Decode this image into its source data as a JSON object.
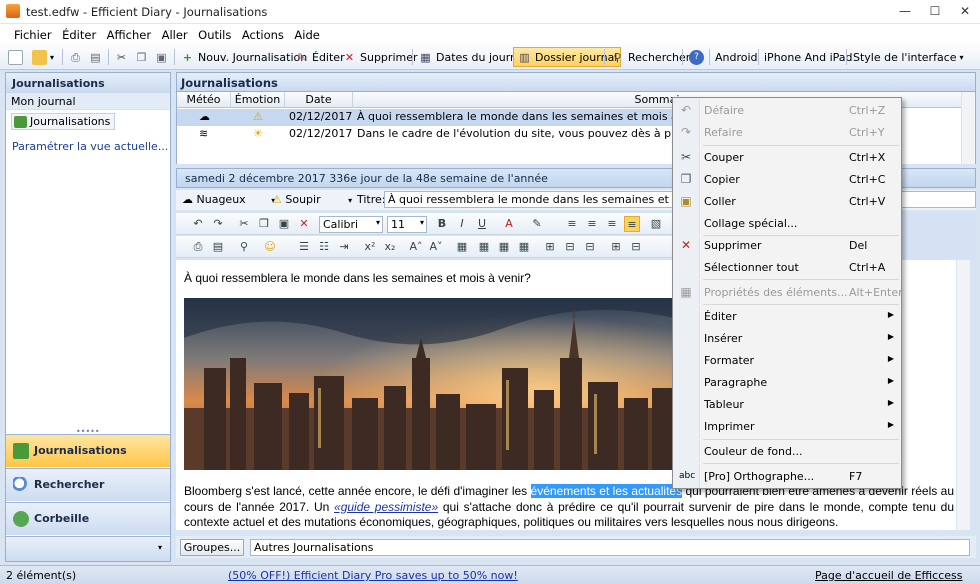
{
  "window": {
    "title": "test.edfw - Efficient Diary - Journalisations",
    "minimize": "—",
    "maximize": "☐",
    "close": "✕"
  },
  "menubar": [
    "Fichier",
    "Éditer",
    "Afficher",
    "Aller",
    "Outils",
    "Actions",
    "Aide"
  ],
  "toolbar": {
    "new_entry": "Nouv. Journalisation",
    "edit": "Éditer",
    "delete": "Supprimer",
    "dates": "Dates du journal",
    "folder": "Dossier journal",
    "search": "Rechercher",
    "help": "?",
    "android": "Android",
    "iphone": "iPhone And iPad",
    "style": "Style de l'interface"
  },
  "left_panel": {
    "header": "Journalisations",
    "journal": "Mon journal",
    "item": "Journalisations",
    "link": "Paramétrer la vue actuelle...",
    "nav": [
      "Journalisations",
      "Rechercher",
      "Corbeille"
    ]
  },
  "main": {
    "header": "Journalisations",
    "columns": [
      "Météo",
      "Émotion",
      "Date",
      "Sommaire"
    ],
    "rows": [
      {
        "date": "02/12/2017",
        "summary": "À quoi ressemblera le monde dans les semaines et mois à venir?"
      },
      {
        "date": "02/12/2017",
        "summary": "Dans le cadre de l'évolution du site, vous pouvez dès à présent prendre"
      }
    ],
    "date_bar": "samedi 2 décembre 2017   336e jour de la 48e semaine de l'année",
    "weather": "Nuageux",
    "emotion": "Soupir",
    "title_label": "Titre:",
    "title_value": "À quoi ressemblera le monde dans les semaines et mois à venir?",
    "font": "Calibri",
    "size": "11"
  },
  "editor": {
    "question": "À quoi ressemblera le monde dans les semaines et mois à venir?",
    "p1": "Bloomberg s'est lancé, cette année encore, le défi d'imaginer les ",
    "highlight": "événements et les actualités",
    "p2": " qui pourraient bien être amenés à devenir réels au cours de l'année 2017. Un ",
    "link": "«guide pessimiste»",
    "p3": " qui s'attache donc à prédire ce qu'il pourrait survenir de pire dans le monde, compte tenu du contexte actuel et des mutations économiques, géographiques, politiques ou militaires vers lesquelles nous nous dirigeons."
  },
  "bottombar": {
    "groups_button": "Groupes...",
    "groups_value": "Autres Journalisations"
  },
  "status": {
    "count": "2 élément(s)",
    "promo": "(50% OFF!) Efficient Diary Pro saves up to 50% now!",
    "home": "Page d'accueil de Efficcess"
  },
  "context_menu": [
    {
      "label": "Défaire",
      "shortcut": "Ctrl+Z",
      "disabled": true,
      "icon": "undo-icon"
    },
    {
      "label": "Refaire",
      "shortcut": "Ctrl+Y",
      "disabled": true,
      "icon": "redo-icon"
    },
    {
      "label": "Couper",
      "shortcut": "Ctrl+X",
      "icon": "cut-icon"
    },
    {
      "label": "Copier",
      "shortcut": "Ctrl+C",
      "icon": "copy-icon"
    },
    {
      "label": "Coller",
      "shortcut": "Ctrl+V",
      "icon": "paste-icon"
    },
    {
      "label": "Collage spécial..."
    },
    {
      "label": "Supprimer",
      "shortcut": "Del",
      "icon": "delete-icon"
    },
    {
      "label": "Sélectionner tout",
      "shortcut": "Ctrl+A"
    },
    {
      "label": "Propriétés des éléments...",
      "shortcut": "Alt+Enter",
      "disabled": true,
      "icon": "properties-icon"
    },
    {
      "label": "Éditer",
      "submenu": true
    },
    {
      "label": "Insérer",
      "submenu": true
    },
    {
      "label": "Formater",
      "submenu": true
    },
    {
      "label": "Paragraphe",
      "submenu": true
    },
    {
      "label": "Tableur",
      "submenu": true
    },
    {
      "label": "Imprimer",
      "submenu": true
    },
    {
      "label": "Couleur de fond..."
    },
    {
      "label": "[Pro] Orthographe...",
      "shortcut": "F7",
      "icon": "spellcheck-icon"
    }
  ]
}
